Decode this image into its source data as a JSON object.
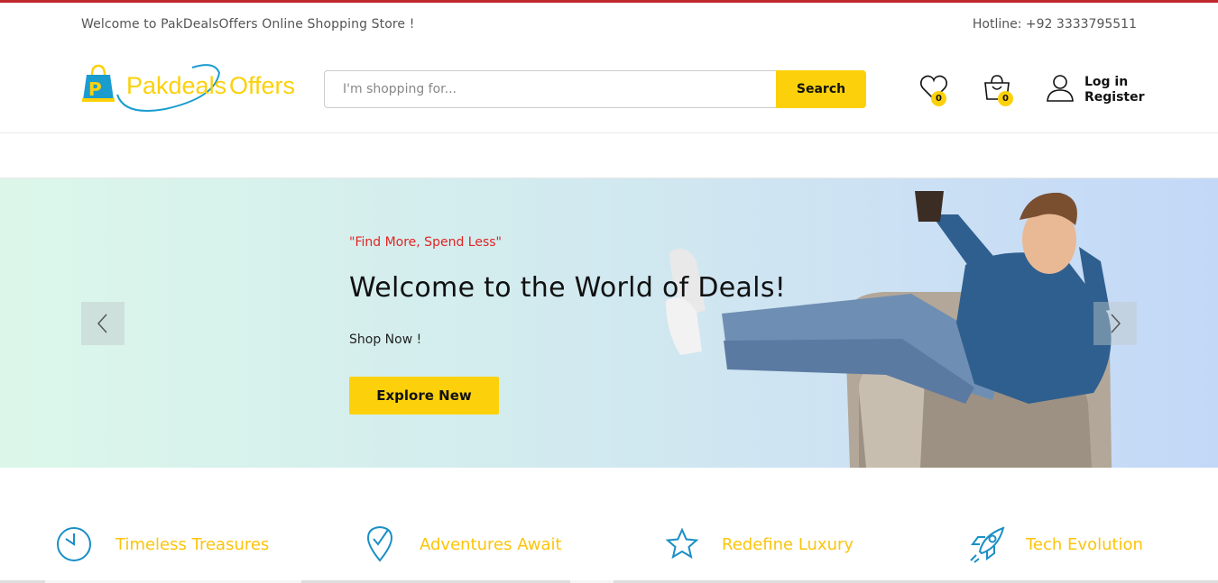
{
  "topbar": {
    "welcome": "Welcome to PakDealsOffers Online Shopping Store !",
    "hotline": "Hotline: +92 3333795511"
  },
  "logo": {
    "text": "Pakdeals Offers",
    "brand_color": "#fcd10b",
    "accent_color": "#1a9ccf"
  },
  "search": {
    "placeholder": "I'm shopping for...",
    "button_label": "Search"
  },
  "header_icons": {
    "wishlist_count": "0",
    "cart_count": "0",
    "login_label": "Log in",
    "register_label": "Register"
  },
  "hero": {
    "tagline": "\"Find More, Spend Less\"",
    "title": "Welcome to the World of Deals!",
    "subtitle": "Shop Now !",
    "button_label": "Explore New",
    "tagline_color": "#e12424",
    "button_color": "#fcd10b"
  },
  "features": [
    {
      "icon": "clock-icon",
      "label": "Timeless Treasures"
    },
    {
      "icon": "location-check-icon",
      "label": "Adventures Await"
    },
    {
      "icon": "star-icon",
      "label": "Redefine Luxury"
    },
    {
      "icon": "rocket-icon",
      "label": "Tech Evolution"
    }
  ],
  "colors": {
    "top_line": "#c0282d",
    "feature_text": "#fcc40a",
    "feature_icon": "#1a8fc6"
  }
}
